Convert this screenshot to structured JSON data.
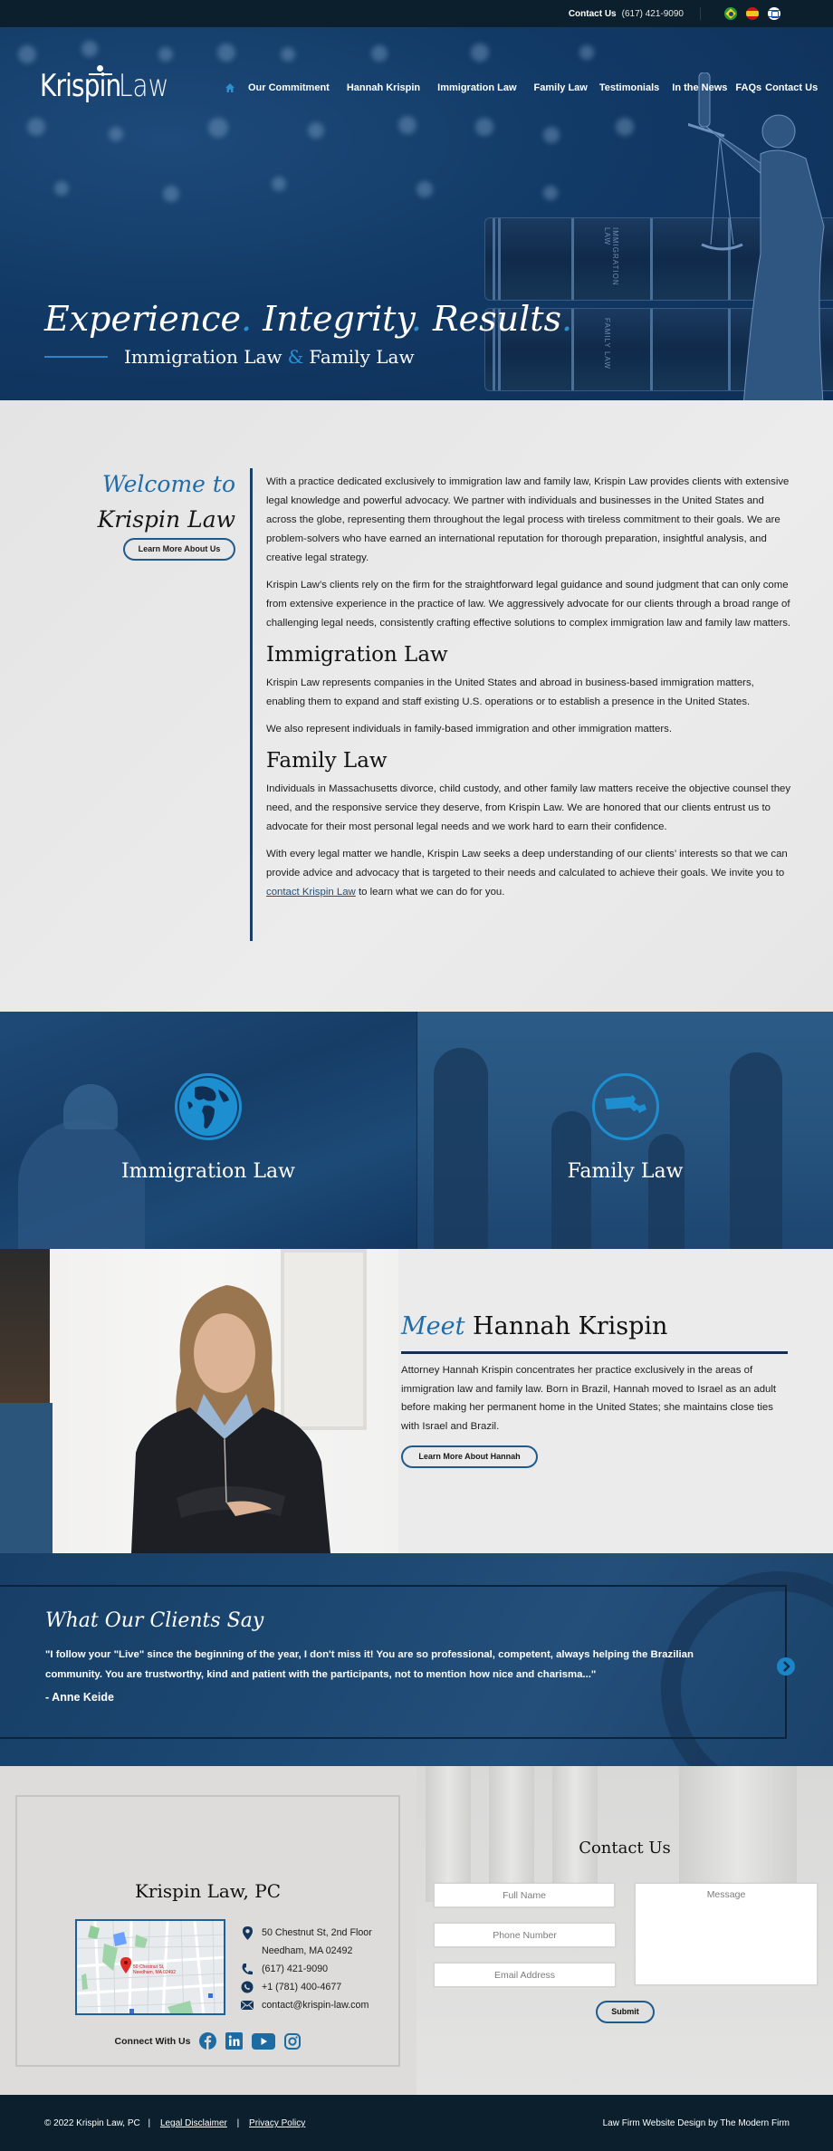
{
  "topbar": {
    "contact_label": "Contact Us",
    "phone": "(617) 421-9090",
    "languages": [
      "Portuguese (Brazil flag)",
      "Spanish (Spain flag)",
      "Hebrew (Israel flag)"
    ]
  },
  "header": {
    "logo_krispin": "Krispin",
    "logo_law": "Law",
    "nav": [
      "Our Commitment",
      "Hannah Krispin",
      "Immigration Law",
      "Family Law",
      "Testimonials",
      "In the News",
      "FAQs",
      "Contact Us"
    ]
  },
  "hero": {
    "tagline_words": [
      "Experience",
      "Integrity",
      "Results"
    ],
    "tagline_dot": ".",
    "sub_left": "Immigration Law",
    "sub_amp": "&",
    "sub_right": "Family Law",
    "book_labels": [
      "IMMIGRATION LAW",
      "FAMILY LAW"
    ]
  },
  "welcome": {
    "line1": "Welcome to",
    "line2": "Krispin Law",
    "button": "Learn More About Us",
    "paragraphs": [
      "With a practice dedicated exclusively to immigration law and family law, Krispin Law provides clients with extensive legal knowledge and powerful advocacy. We partner with individuals and businesses in the United States and across the globe, representing them throughout the legal process with tireless commitment to their goals. We are problem-solvers who have earned an international reputation for thorough preparation, insightful analysis, and creative legal strategy.",
      "Krispin Law’s clients rely on the firm for the straightforward legal guidance and sound judgment that can only come from extensive experience in the practice of law. We aggressively advocate for our clients through a broad range of challenging legal needs, consistently crafting effective solutions to complex immigration law and family law matters."
    ],
    "immigration_heading": "Immigration Law",
    "immigration_paragraphs": [
      "Krispin Law represents companies in the United States and abroad in business-based immigration matters, enabling them to expand and staff existing U.S. operations or to establish a presence in the United States.",
      "We also represent individuals in family-based immigration and other immigration matters."
    ],
    "family_heading": "Family Law",
    "family_paragraph": "Individuals in Massachusetts divorce, child custody, and other family law matters receive the objective counsel they need, and the responsive service they deserve, from Krispin Law. We are honored that our clients entrust us to advocate for their most personal legal needs and we work hard to earn their confidence.",
    "closing_before": "With every legal matter we handle, Krispin Law seeks a deep understanding of our clients’ interests so that we can provide advice and advocacy that is targeted to their needs and calculated to achieve their goals. We invite you to ",
    "closing_link": "contact Krispin Law",
    "closing_after": " to learn what we can do for you."
  },
  "practice_areas": [
    {
      "title": "Immigration Law",
      "icon": "globe-icon"
    },
    {
      "title": "Family Law",
      "icon": "massachusetts-map-icon"
    }
  ],
  "meet": {
    "meet_word": "Meet",
    "name": "Hannah Krispin",
    "body": "Attorney Hannah Krispin concentrates her practice exclusively in the areas of immigration law and family law. Born in Brazil, Hannah moved to Israel as an adult before making her permanent home in the United States; she maintains close ties with Israel and Brazil.",
    "button": "Learn More About Hannah"
  },
  "testimonials": {
    "title": "What Our Clients Say",
    "quote": "\"I follow your \"Live\" since the beginning of the year, I don't miss it! You are so professional, competent, always helping the Brazilian community. You are trustworthy, kind and patient with the participants, not to mention how nice and charisma...\"",
    "author": "- Anne Keide"
  },
  "office": {
    "firm_name": "Krispin Law, PC",
    "map_label_1": "50 Chestnut St,",
    "map_label_2": "Needham, MA 02492",
    "address_line1": "50 Chestnut St, 2nd Floor",
    "address_line2": "Needham, MA 02492",
    "phone": "(617) 421-9090",
    "whatsapp": "+1 (781) 400-4677",
    "email": "contact@krispin-law.com",
    "connect_label": "Connect With Us",
    "socials": [
      "facebook",
      "linkedin",
      "youtube",
      "instagram"
    ]
  },
  "contact_form": {
    "title": "Contact Us",
    "full_name_placeholder": "Full Name",
    "phone_placeholder": "Phone Number",
    "email_placeholder": "Email Address",
    "message_placeholder": "Message",
    "submit": "Submit"
  },
  "footer": {
    "copyright": "© 2022 Krispin Law, PC",
    "sep": "|",
    "legal": "Legal Disclaimer",
    "privacy": "Privacy Policy",
    "credit": "Law Firm Website Design by The Modern Firm"
  },
  "colors": {
    "navy": "#0c1f2d",
    "hero_blue": "#123a66",
    "accent_blue": "#1f6ca8",
    "bright_blue": "#1d8fd0",
    "rule_navy": "#132f52"
  }
}
